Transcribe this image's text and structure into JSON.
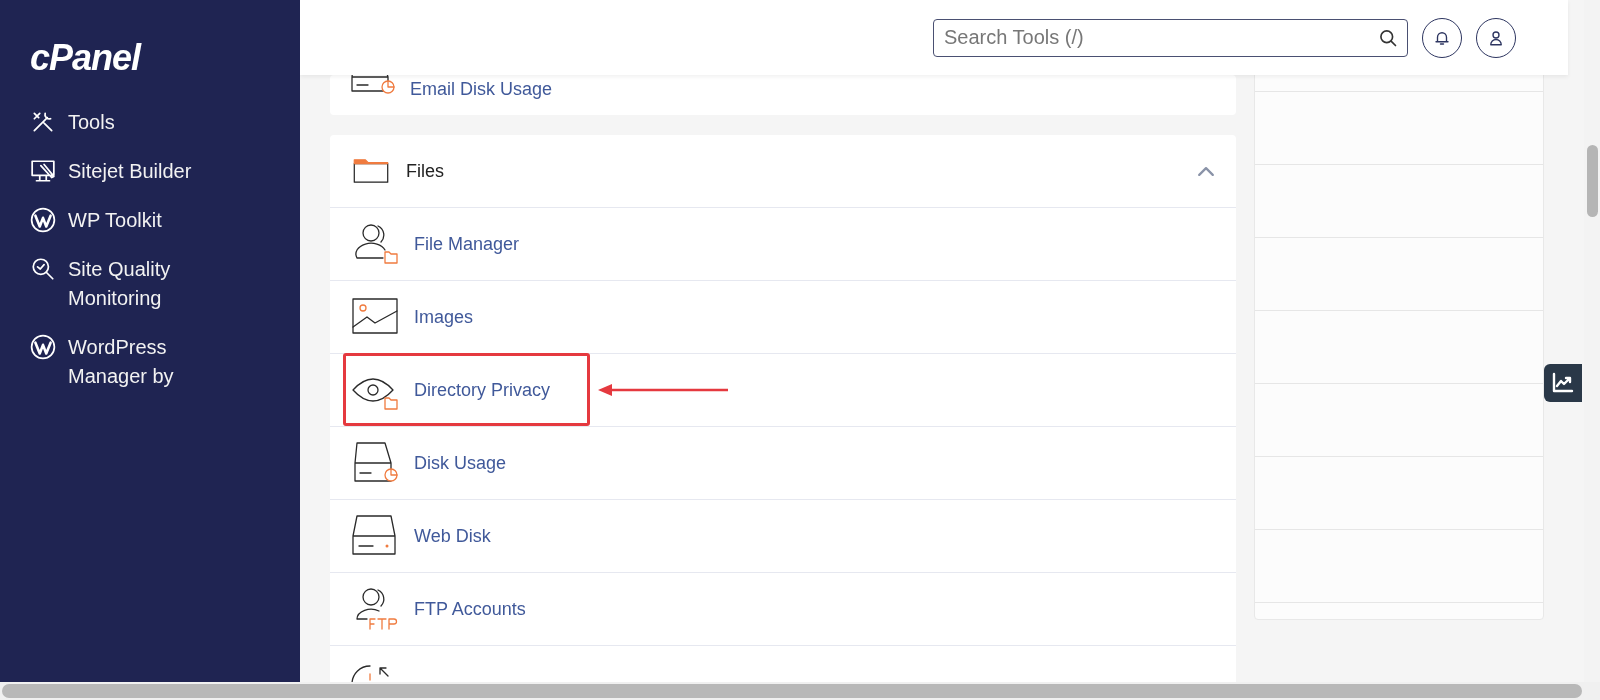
{
  "sidebar": {
    "logo": "cPanel",
    "items": [
      {
        "kind": "tools",
        "label": "Tools"
      },
      {
        "kind": "sitejet",
        "label": "Sitejet Builder"
      },
      {
        "kind": "wordpress",
        "label": "WP Toolkit"
      },
      {
        "kind": "quality",
        "label": "Site Quality Monitoring"
      },
      {
        "kind": "wordpress",
        "label": "WordPress Manager by"
      }
    ]
  },
  "header": {
    "search": {
      "placeholder": "Search Tools (/)"
    }
  },
  "sections": [
    {
      "rows": [
        {
          "kind": "email-disk",
          "label": "Email Disk Usage",
          "annotated": false
        }
      ]
    },
    {
      "title": "Files",
      "expanded": true,
      "rows": [
        {
          "kind": "file-manager",
          "label": "File Manager",
          "annotated": false
        },
        {
          "kind": "images",
          "label": "Images",
          "annotated": false
        },
        {
          "kind": "privacy",
          "label": "Directory Privacy",
          "annotated": true
        },
        {
          "kind": "disk",
          "label": "Disk Usage",
          "annotated": false
        },
        {
          "kind": "web-disk",
          "label": "Web Disk",
          "annotated": false
        },
        {
          "kind": "ftp",
          "label": "FTP Accounts",
          "annotated": false
        },
        {
          "kind": "backup",
          "annotated": false
        }
      ]
    }
  ]
}
